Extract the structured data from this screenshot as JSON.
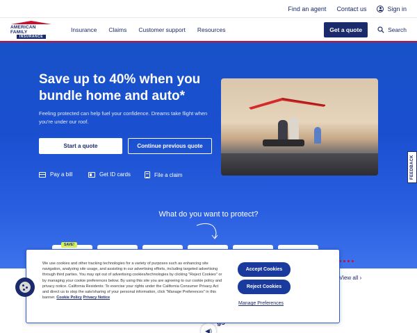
{
  "utility_bar": {
    "find_agent": "Find an agent",
    "contact_us": "Contact us",
    "sign_in": "Sign in"
  },
  "logo": {
    "line1": "AMERICAN FAMILY",
    "line2": "INSURANCE"
  },
  "nav": {
    "items": [
      "Insurance",
      "Claims",
      "Customer support",
      "Resources"
    ],
    "get_quote": "Get a quote",
    "search": "Search"
  },
  "hero": {
    "headline": "Save up to 40% when you bundle home and auto*",
    "subtext": "Feeling protected can help fuel your confidence. Dreams take flight when you're under our roof.",
    "start_quote": "Start a quote",
    "continue_quote": "Continue previous quote",
    "quick_links": [
      "Pay a bill",
      "Get ID cards",
      "File a claim"
    ],
    "protect_heading": "What do you want to protect?",
    "save_badge": "SAVE!"
  },
  "feedback_tab": "FEEDBACK",
  "behind_banner": {
    "view_all": "View all",
    "partial_text": "gs"
  },
  "cookie_banner": {
    "body": "We use cookies and other tracking technologies for a variety of purposes such as enhancing site navigation, analyzing site usage, and assisting in our advertising efforts, including targeted advertising through third parties. You may opt out of advertising cookies/technologies by clicking \"Reject Cookies\" or by managing your cookie preferences below. By using this site you are agreeing to our cookie policy and privacy notice. California Residents: To exercise your rights under the California Consumer Privacy Act and direct us to stop the sale/sharing of your personal information, click \"Manage Preferences\" in this banner.",
    "cookie_policy_link": "Cookie Policy",
    "privacy_link_1": "Privacy",
    "privacy_link_2": "Notice",
    "accept": "Accept Cookies",
    "reject": "Reject Cookies",
    "manage": "Manage Preferences"
  },
  "colors": {
    "brand_navy": "#1b2a6b",
    "brand_red": "#c8102e",
    "hero_blue": "#1a4fd0",
    "cookie_button": "#1b3a9e"
  },
  "icons": [
    "user-icon",
    "search-icon",
    "credit-card-icon",
    "id-card-icon",
    "document-icon",
    "chevron-right-icon",
    "cookie-icon",
    "audio-icon"
  ]
}
